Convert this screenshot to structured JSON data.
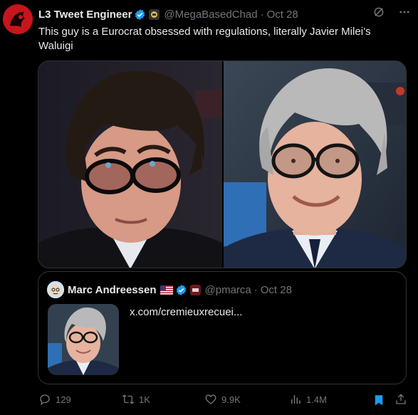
{
  "tweet": {
    "author_name": "L3 Tweet Engineer",
    "handle": "@MegaBasedChad",
    "separator": "·",
    "date": "Oct 28",
    "text": "This guy is a Eurocrat obsessed with regulations, literally Javier Milei’s Waluigi",
    "avatar_color": "#c4161c"
  },
  "quote": {
    "author_name": "Marc Andreessen",
    "handle": "@pmarca",
    "separator": "·",
    "date": "Oct 28",
    "link_text": "x.com/cremieuxrecuei..."
  },
  "actions": {
    "replies": "129",
    "reposts": "1K",
    "likes": "9.9K",
    "views": "1.4M"
  },
  "colors": {
    "background": "#000000",
    "text": "#e7e9ea",
    "muted": "#71767b",
    "verified": "#1d9bf0",
    "bookmark": "#1d9bf0",
    "border": "#2f3336"
  },
  "icons": {
    "verified": "verified-badge-icon",
    "grok": "grok-icon",
    "more": "more-icon",
    "reply": "reply-icon",
    "repost": "repost-icon",
    "like": "like-icon",
    "views": "views-icon",
    "bookmark": "bookmark-icon",
    "share": "share-icon"
  }
}
